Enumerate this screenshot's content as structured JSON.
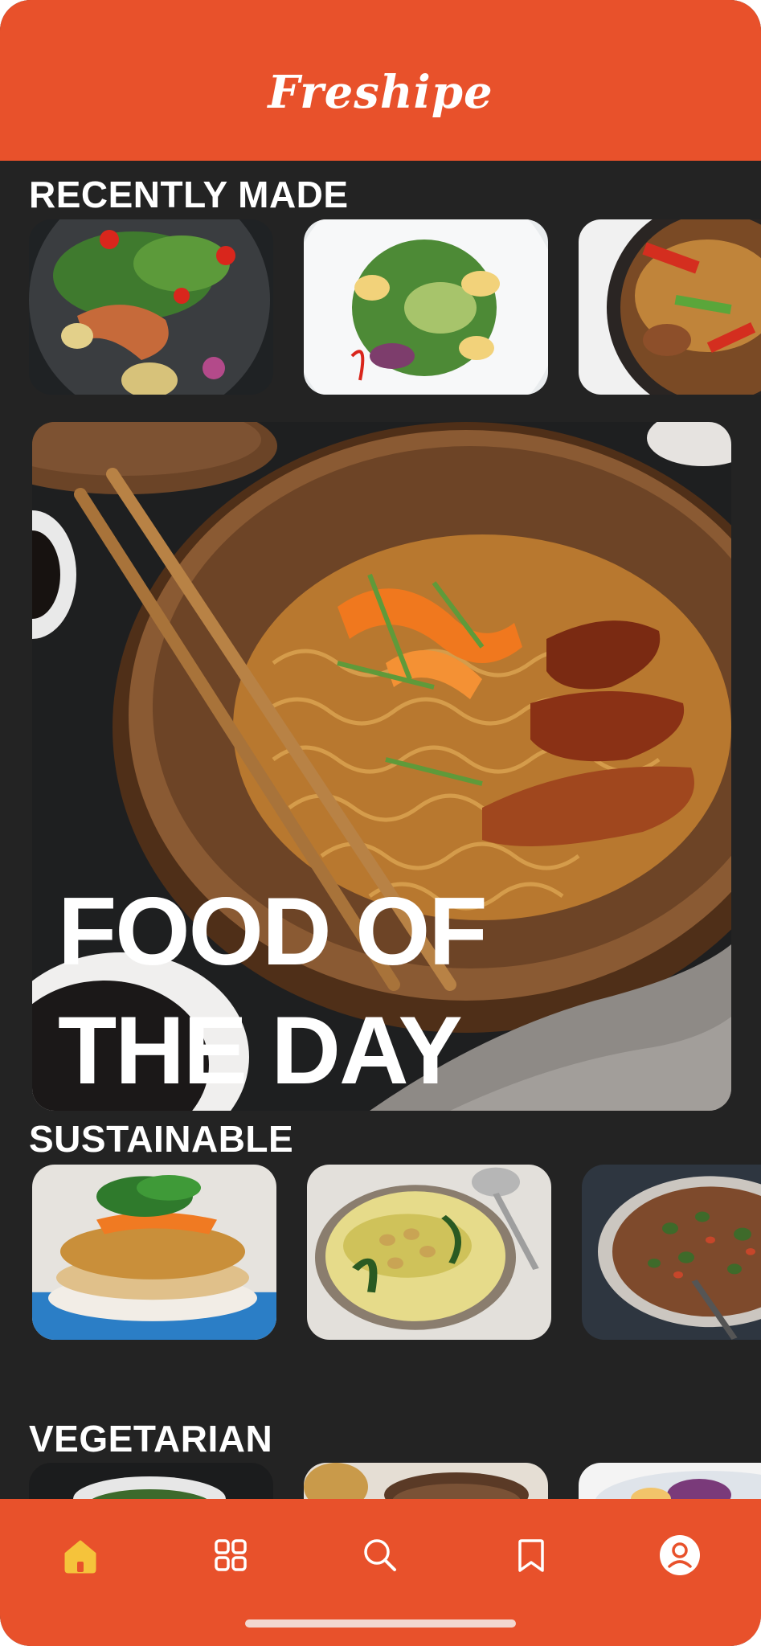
{
  "app": {
    "title": "Freshipe"
  },
  "sections": {
    "recently_made": {
      "title": "RECENTLY MADE",
      "images": [
        "salmon-salad",
        "avocado-salad",
        "stir-fry-noodles"
      ]
    },
    "food_of_day": {
      "headline_line1": "FOOD OF",
      "headline_line2": "THE DAY",
      "image": "noodles-with-chicken"
    },
    "sustainable": {
      "title": "SUSTAINABLE",
      "images": [
        "veggie-burger",
        "chickpea-curry",
        "lentil-stew"
      ]
    },
    "vegetarian": {
      "title": "VEGETARIAN",
      "images": [
        "salad-bowl",
        "pasta",
        "slaw-plate"
      ]
    }
  },
  "nav": {
    "items": [
      {
        "icon": "home-icon",
        "active": true
      },
      {
        "icon": "grid-icon",
        "active": false
      },
      {
        "icon": "search-icon",
        "active": false
      },
      {
        "icon": "bookmark-icon",
        "active": false
      },
      {
        "icon": "profile-icon",
        "active": false
      }
    ],
    "active_color": "#F5C33B",
    "inactive_color": "#FFFFFF"
  },
  "colors": {
    "brand": "#E8512B",
    "background": "#232323"
  }
}
